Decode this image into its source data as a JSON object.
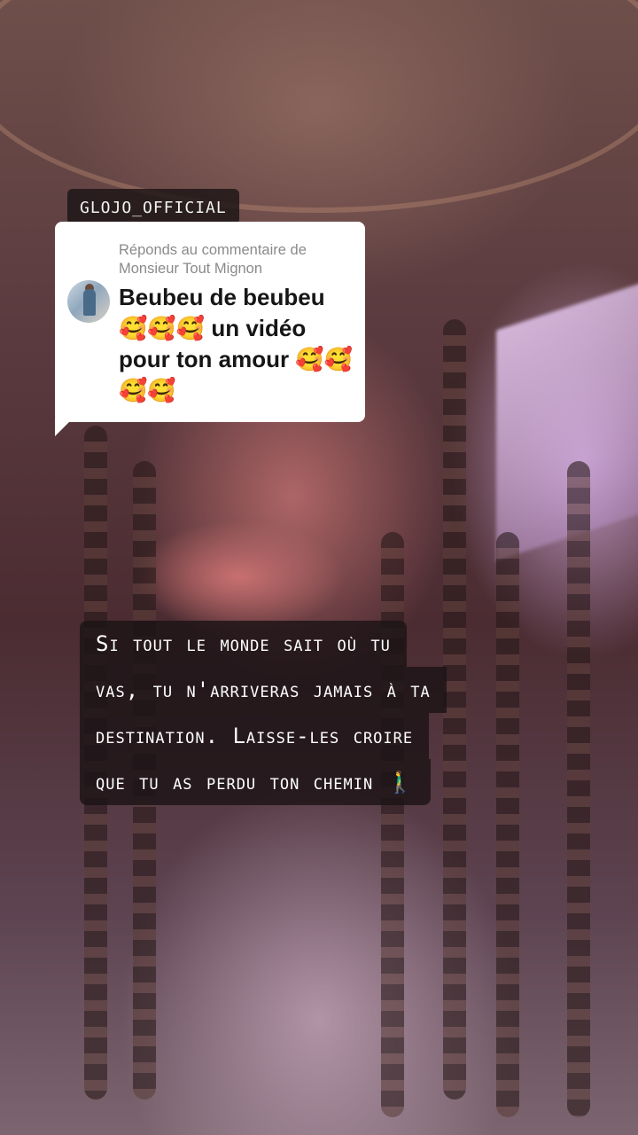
{
  "video": {
    "username_tag": "GLOJO_OFFICIAL"
  },
  "reply_comment": {
    "label": "Réponds au commentaire de Monsieur Tout Mignon",
    "text": "Beubeu de beubeu 🥰🥰🥰 un vidéo pour ton amour 🥰🥰🥰🥰"
  },
  "caption": {
    "lines": [
      "Si tout le monde sait où tu",
      "vas, tu n'arriveras jamais à ta",
      "destination. Laisse-les croire",
      "que tu as perdu ton chemin 🚶‍♂️"
    ]
  }
}
